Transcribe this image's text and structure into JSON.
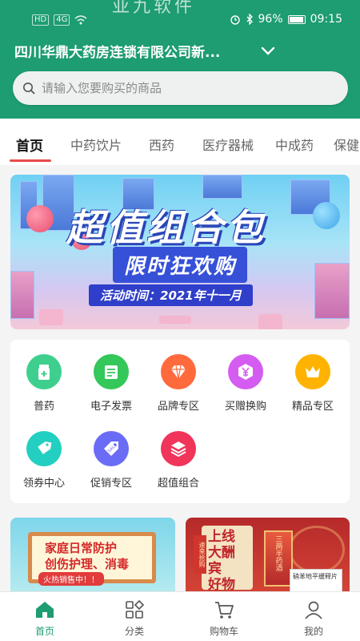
{
  "status_bar": {
    "network_left": [
      "HD",
      "4G"
    ],
    "battery": "96%",
    "time": "09:15"
  },
  "header": {
    "ghost_title": "亚九软件",
    "store_name": "四川华鼎大药房连锁有限公司新...",
    "search_placeholder": "请输入您要购买的商品",
    "accent_color": "#1e9c72"
  },
  "tabs": [
    {
      "label": "首页",
      "active": true
    },
    {
      "label": "中药饮片",
      "active": false
    },
    {
      "label": "西药",
      "active": false
    },
    {
      "label": "医疗器械",
      "active": false
    },
    {
      "label": "中成药",
      "active": false
    },
    {
      "label": "保健",
      "active": false
    }
  ],
  "banner": {
    "title": "超值组合包",
    "subtitle": "限时狂欢购",
    "time_text": "活动时间：2021年十一月"
  },
  "categories": [
    {
      "label": "普药",
      "icon": "medicine-bottle-icon",
      "color": "#3ecf8e"
    },
    {
      "label": "电子发票",
      "icon": "invoice-icon",
      "color": "#34c759"
    },
    {
      "label": "品牌专区",
      "icon": "diamond-icon",
      "color": "#ff6a3d"
    },
    {
      "label": "买赠换购",
      "icon": "yen-hexagon-icon",
      "color": "#d45cf0"
    },
    {
      "label": "精品专区",
      "icon": "crown-icon",
      "color": "#ffb300"
    },
    {
      "label": "领券中心",
      "icon": "coupon-tag-icon",
      "color": "#23cfc0"
    },
    {
      "label": "促销专区",
      "icon": "sale-tag-icon",
      "color": "#6b6cf5"
    },
    {
      "label": "超值组合",
      "icon": "layers-icon",
      "color": "#f0345a"
    }
  ],
  "promos": {
    "left": {
      "line1": "家庭日常防护",
      "line2": "创伤护理、消毒",
      "tag": "火热销售中！！"
    },
    "right": {
      "headline": "上线大酬宾",
      "line2": "好物随心",
      "side_tag": "速来抢购",
      "box_text": "三两半药酒",
      "box2_text": "硝苯地平缓释片"
    }
  },
  "bottom_nav": [
    {
      "label": "首页",
      "icon": "home-icon",
      "active": true
    },
    {
      "label": "分类",
      "icon": "category-grid-icon",
      "active": false
    },
    {
      "label": "购物车",
      "icon": "cart-icon",
      "active": false
    },
    {
      "label": "我的",
      "icon": "user-icon",
      "active": false
    }
  ]
}
